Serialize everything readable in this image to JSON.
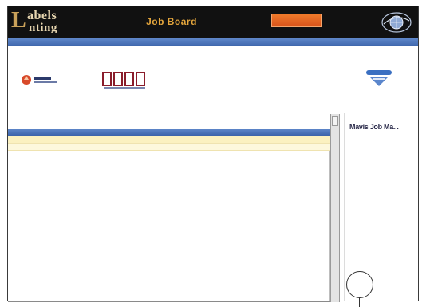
{
  "header": {
    "logo_line1": "abels",
    "logo_line2": "nting",
    "app_title": "Job Board",
    "action_button_label": ""
  },
  "nav": {
    "items": []
  },
  "branding": {
    "mid_logo_text": "",
    "mid_logo_subtext": ""
  },
  "table": {
    "columns": [
      "",
      "",
      "",
      "",
      "",
      ""
    ],
    "rows": [
      {
        "cells": [
          "",
          "",
          "",
          "",
          ""
        ],
        "action": ""
      },
      {
        "cells": [
          "",
          "",
          "",
          "",
          ""
        ],
        "action": ""
      }
    ]
  },
  "side_panel": {
    "title": "Mavis Job Ma..."
  },
  "colors": {
    "header_bg": "#111111",
    "title_accent": "#e3a53c",
    "button_orange": "#e8632a",
    "nav_blue": "#4a72b8",
    "row_highlight": "#fbf1c0"
  },
  "icons": {
    "header_globe": "globe-icon",
    "brand_left": "company-logo",
    "brand_right": "badge-icon"
  }
}
